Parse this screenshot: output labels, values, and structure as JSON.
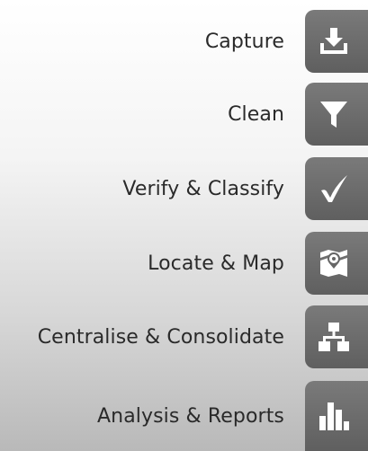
{
  "steps": [
    {
      "label": "Capture",
      "icon": "download-tray-icon"
    },
    {
      "label": "Clean",
      "icon": "funnel-filter-icon"
    },
    {
      "label": "Verify & Classify",
      "icon": "checkmark-icon"
    },
    {
      "label": "Locate & Map",
      "icon": "map-location-icon"
    },
    {
      "label": "Centralise & Consolidate",
      "icon": "hierarchy-network-icon"
    },
    {
      "label": "Analysis & Reports",
      "icon": "bar-chart-icon"
    }
  ],
  "colors": {
    "tile": "#6a6a6a",
    "icon": "#ffffff",
    "text": "#2a2a2a"
  }
}
